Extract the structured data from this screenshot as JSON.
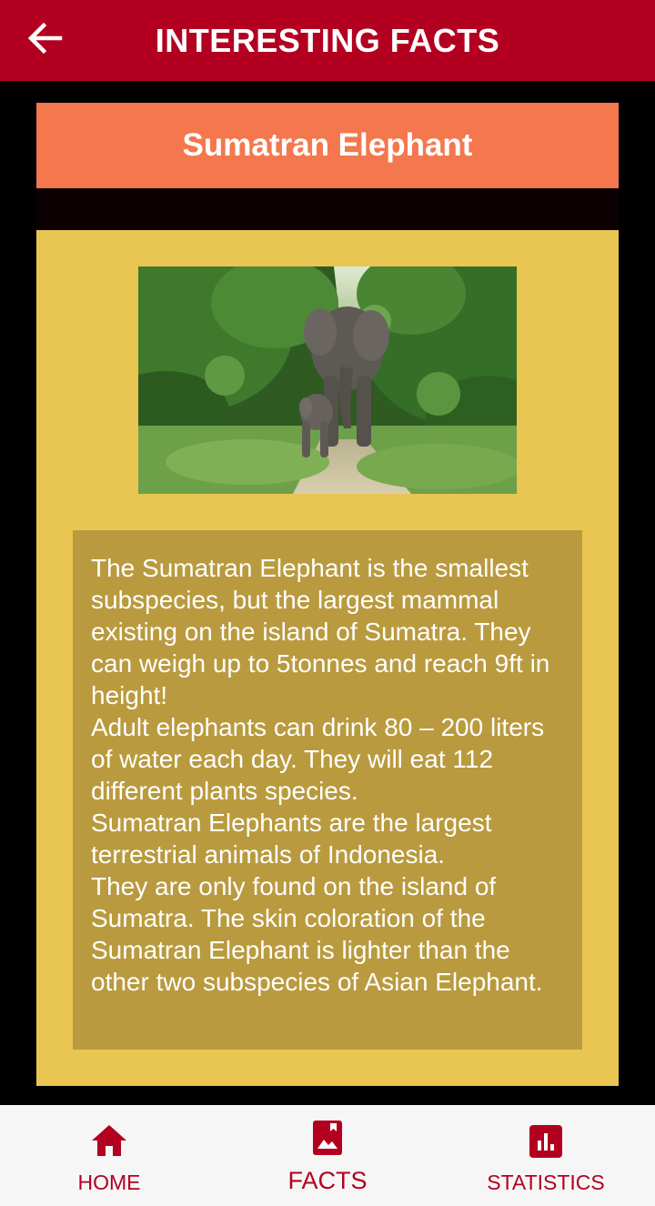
{
  "appbar": {
    "title": "INTERESTING FACTS",
    "back_icon": "arrow-left-icon"
  },
  "card": {
    "title": "Sumatran Elephant",
    "image_alt": "Sumatran elephant with calf on forest path",
    "text": "The Sumatran Elephant is the smallest subspecies, but the largest mammal existing on the island of Sumatra. They can weigh up to 5tonnes and reach 9ft in height!\nAdult elephants can drink 80 – 200 liters of water each day. They will eat 112 different plants species.\nSumatran Elephants are the largest terrestrial animals of Indonesia.\nThey are only found on the island of Sumatra. The skin coloration of the Sumatran Elephant is lighter than the other two subspecies of Asian Elephant."
  },
  "nav": {
    "items": [
      {
        "label": "HOME",
        "icon": "home-icon"
      },
      {
        "label": "FACTS",
        "icon": "image-icon",
        "active": true
      },
      {
        "label": "STATISTICS",
        "icon": "bar-chart-icon"
      }
    ]
  },
  "colors": {
    "primary": "#B30020",
    "title_card": "#F4774D",
    "content_card": "#E9C551",
    "facts_box": "#B99A3E",
    "nav_background": "#F6F6F6"
  }
}
